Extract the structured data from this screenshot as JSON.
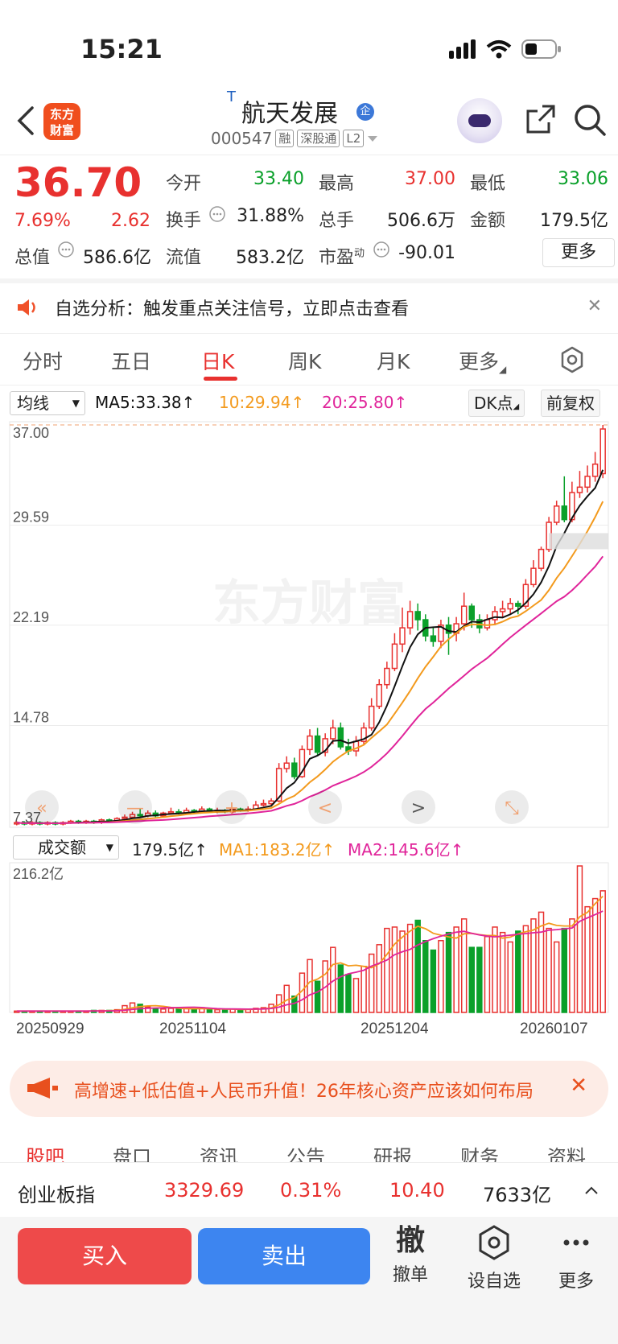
{
  "status_bar": {
    "time": "15:21"
  },
  "header": {
    "stock_name": "航天发展",
    "name_prefix": "T",
    "name_badge": "企",
    "stock_code": "000547",
    "tags": [
      "融",
      "深股通",
      "L2"
    ],
    "logo_line1": "东方",
    "logo_line2": "财富"
  },
  "quote": {
    "price": "36.70",
    "change_pct": "7.69%",
    "change": "2.62",
    "fields": [
      {
        "label": "今开",
        "value": "33.40",
        "color": "green"
      },
      {
        "label": "最高",
        "value": "37.00",
        "color": "red"
      },
      {
        "label": "最低",
        "value": "33.06",
        "color": "green"
      },
      {
        "label": "换手",
        "value": "31.88%",
        "color": "dark"
      },
      {
        "label": "总手",
        "value": "506.6万",
        "color": "dark"
      },
      {
        "label": "金额",
        "value": "179.5亿",
        "color": "dark"
      },
      {
        "label": "总值",
        "value": "586.6亿",
        "color": "dark"
      },
      {
        "label": "流值",
        "value": "583.2亿",
        "color": "dark"
      },
      {
        "label": "市盈",
        "value": "-90.01",
        "color": "dark"
      }
    ],
    "pe_superscript": "动",
    "more_label": "更多"
  },
  "notice": {
    "text": "自选分析：触发重点关注信号，立即点击查看"
  },
  "tabs": [
    "分时",
    "五日",
    "日K",
    "周K",
    "月K",
    "更多"
  ],
  "active_tab": "日K",
  "kline_legend": {
    "indicator_select": "均线",
    "ma5": "MA5:33.38",
    "ma10": "10:29.94",
    "ma20": "20:25.80",
    "dk_label": "DK点",
    "adjust_label": "前复权"
  },
  "volume_legend": {
    "indicator_select": "成交额",
    "value": "179.5亿",
    "ma1": "MA1:183.2亿",
    "ma2": "MA2:145.6亿",
    "max_label": "216.2亿"
  },
  "watermark": "东方财富",
  "colors": {
    "up": "#e8312f",
    "down": "#0aa02a",
    "ma5": "#111111",
    "ma10": "#f39a1d",
    "ma20": "#e0249a",
    "accent": "#e8312f"
  },
  "chart_data": {
    "type": "candlestick",
    "y_ticks": [
      "37.00",
      "29.59",
      "22.19",
      "14.78",
      "7.37"
    ],
    "ylim": [
      7.37,
      37.0
    ],
    "x_ticks": [
      "20250929",
      "20251104",
      "20251204",
      "20260107"
    ],
    "candles": [
      [
        7.5,
        7.6,
        7.4,
        7.7
      ],
      [
        7.6,
        7.5,
        7.4,
        7.7
      ],
      [
        7.5,
        7.6,
        7.4,
        7.7
      ],
      [
        7.6,
        7.5,
        7.4,
        7.7
      ],
      [
        7.5,
        7.6,
        7.4,
        7.7
      ],
      [
        7.6,
        7.5,
        7.4,
        7.7
      ],
      [
        7.5,
        7.6,
        7.4,
        7.7
      ],
      [
        7.6,
        7.7,
        7.5,
        7.8
      ],
      [
        7.7,
        7.6,
        7.5,
        7.8
      ],
      [
        7.6,
        7.7,
        7.5,
        7.8
      ],
      [
        7.7,
        7.6,
        7.5,
        7.8
      ],
      [
        7.6,
        7.8,
        7.5,
        7.9
      ],
      [
        7.8,
        7.7,
        7.6,
        7.9
      ],
      [
        7.7,
        7.9,
        7.6,
        8.0
      ],
      [
        7.9,
        8.0,
        7.8,
        8.2
      ],
      [
        8.0,
        8.2,
        7.9,
        8.4
      ],
      [
        8.2,
        8.1,
        8.0,
        8.6
      ],
      [
        8.1,
        8.3,
        8.0,
        8.5
      ],
      [
        8.3,
        8.1,
        8.0,
        8.5
      ],
      [
        8.1,
        8.3,
        8.0,
        8.4
      ],
      [
        8.3,
        8.4,
        8.2,
        8.7
      ],
      [
        8.4,
        8.3,
        8.2,
        8.6
      ],
      [
        8.3,
        8.5,
        8.2,
        8.7
      ],
      [
        8.5,
        8.4,
        8.3,
        8.6
      ],
      [
        8.4,
        8.6,
        8.3,
        8.8
      ],
      [
        8.6,
        8.5,
        8.4,
        8.7
      ],
      [
        8.5,
        8.5,
        8.3,
        8.7
      ],
      [
        8.5,
        8.4,
        8.3,
        8.6
      ],
      [
        8.4,
        8.6,
        8.3,
        8.7
      ],
      [
        8.6,
        8.5,
        8.4,
        8.7
      ],
      [
        8.5,
        8.6,
        8.4,
        8.8
      ],
      [
        8.6,
        8.9,
        8.5,
        9.2
      ],
      [
        8.9,
        9.0,
        8.8,
        9.3
      ],
      [
        9.0,
        9.2,
        8.9,
        9.4
      ],
      [
        9.2,
        11.6,
        9.1,
        12.0
      ],
      [
        11.6,
        12.0,
        11.3,
        12.5
      ],
      [
        12.0,
        11.0,
        10.8,
        12.4
      ],
      [
        11.0,
        13.0,
        10.9,
        13.3
      ],
      [
        13.0,
        14.0,
        12.6,
        14.5
      ],
      [
        14.0,
        12.8,
        12.5,
        14.6
      ],
      [
        12.8,
        13.8,
        12.5,
        14.2
      ],
      [
        13.8,
        14.6,
        13.4,
        15.2
      ],
      [
        14.6,
        13.2,
        13.0,
        15.0
      ],
      [
        13.2,
        12.9,
        12.6,
        13.8
      ],
      [
        12.9,
        13.6,
        12.5,
        14.0
      ],
      [
        13.6,
        14.6,
        13.4,
        15.0
      ],
      [
        14.6,
        16.2,
        14.4,
        16.8
      ],
      [
        16.2,
        17.8,
        16.0,
        18.2
      ],
      [
        17.8,
        19.0,
        17.5,
        19.5
      ],
      [
        19.0,
        20.8,
        18.8,
        21.6
      ],
      [
        20.8,
        22.0,
        20.2,
        23.5
      ],
      [
        22.0,
        23.2,
        21.5,
        24.0
      ],
      [
        23.2,
        22.6,
        21.8,
        23.8
      ],
      [
        22.6,
        21.4,
        21.0,
        23.0
      ],
      [
        21.4,
        21.0,
        20.6,
        22.0
      ],
      [
        21.0,
        22.2,
        20.5,
        22.6
      ],
      [
        22.2,
        21.6,
        20.0,
        22.8
      ],
      [
        21.6,
        22.3,
        21.0,
        22.8
      ],
      [
        22.3,
        23.6,
        21.8,
        24.6
      ],
      [
        23.6,
        22.6,
        22.0,
        23.8
      ],
      [
        22.6,
        22.0,
        21.6,
        23.0
      ],
      [
        22.0,
        22.6,
        21.8,
        23.0
      ],
      [
        22.6,
        23.2,
        22.2,
        23.6
      ],
      [
        23.2,
        23.4,
        22.8,
        24.0
      ],
      [
        23.4,
        23.8,
        23.0,
        24.2
      ],
      [
        23.8,
        23.6,
        23.0,
        24.0
      ],
      [
        23.6,
        25.2,
        23.4,
        25.6
      ],
      [
        25.2,
        26.4,
        25.0,
        27.0
      ],
      [
        26.4,
        27.8,
        26.2,
        28.0
      ],
      [
        27.8,
        29.8,
        27.6,
        30.2
      ],
      [
        29.8,
        31.0,
        29.6,
        31.4
      ],
      [
        31.0,
        30.0,
        29.8,
        33.2
      ],
      [
        30.0,
        32.0,
        29.8,
        32.8
      ],
      [
        32.0,
        32.4,
        31.6,
        33.6
      ],
      [
        32.4,
        33.2,
        32.0,
        34.0
      ],
      [
        33.2,
        34.1,
        32.8,
        35.0
      ],
      [
        33.4,
        36.7,
        33.06,
        37.0
      ]
    ],
    "volume": [
      0.2,
      0.2,
      0.2,
      0.2,
      0.2,
      0.2,
      0.2,
      0.2,
      0.2,
      0.2,
      0.3,
      0.3,
      0.3,
      0.4,
      1.0,
      1.4,
      1.2,
      0.8,
      0.6,
      0.5,
      0.6,
      0.5,
      0.6,
      0.5,
      0.6,
      0.5,
      0.4,
      0.4,
      0.5,
      0.4,
      0.5,
      0.6,
      0.7,
      1.2,
      2.6,
      4.0,
      2.4,
      5.8,
      7.8,
      4.6,
      7.6,
      9.6,
      7.0,
      5.6,
      5.0,
      6.8,
      8.6,
      10.0,
      12.4,
      12.6,
      12.0,
      13.0,
      13.6,
      10.6,
      9.2,
      10.6,
      11.8,
      12.6,
      13.8,
      9.6,
      9.6,
      11.2,
      12.6,
      11.8,
      10.4,
      12.0,
      12.8,
      13.8,
      14.8,
      12.4,
      10.4,
      12.4,
      13.8,
      21.62,
      15.6,
      16.8,
      17.95
    ],
    "volume_color": "up_down_by_candle"
  },
  "news": {
    "text": "高增速+低估值+人民币升值！26年核心资产应该如何布局"
  },
  "bottom_tabs": [
    "股吧",
    "盘口",
    "资讯",
    "公告",
    "研报",
    "财务",
    "资料"
  ],
  "index_bar": {
    "name": "创业板指",
    "value": "3329.69",
    "pct": "0.31%",
    "change": "10.40",
    "amount": "7633亿"
  },
  "actions": {
    "buy": "买入",
    "sell": "卖出",
    "cancel_icon": "撤",
    "cancel_label": "撤单",
    "watch_label": "设自选",
    "more_label": "更多"
  }
}
